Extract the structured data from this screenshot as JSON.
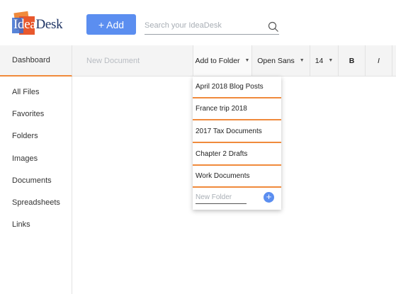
{
  "app": {
    "logo_text_a": "Idea",
    "logo_text_b": "Desk"
  },
  "header": {
    "add_label": "+ Add",
    "search_placeholder": "Search your IdeaDesk",
    "search_icon": "search-icon"
  },
  "toolbar": {
    "dashboard_label": "Dashboard",
    "document_placeholder": "New Document",
    "add_to_folder_label": "Add to Folder",
    "font_label": "Open Sans",
    "size_label": "14",
    "bold_label": "B",
    "italic_label": "I",
    "caret_icon": "chevron-down-icon"
  },
  "sidebar": {
    "items": [
      {
        "label": "All Files"
      },
      {
        "label": "Favorites"
      },
      {
        "label": "Folders"
      },
      {
        "label": "Images"
      },
      {
        "label": "Documents"
      },
      {
        "label": "Spreadsheets"
      },
      {
        "label": "Links"
      }
    ]
  },
  "folder_menu": {
    "items": [
      {
        "label": "April 2018 Blog Posts"
      },
      {
        "label": "France trip 2018"
      },
      {
        "label": "2017 Tax Documents"
      },
      {
        "label": "Chapter 2 Drafts"
      },
      {
        "label": "Work Documents"
      }
    ],
    "new_folder_placeholder": "New Folder",
    "add_icon_glyph": "+"
  },
  "colors": {
    "accent_orange": "#f08a3c",
    "accent_blue": "#5b8ef0",
    "logo_navy": "#1f3565"
  }
}
